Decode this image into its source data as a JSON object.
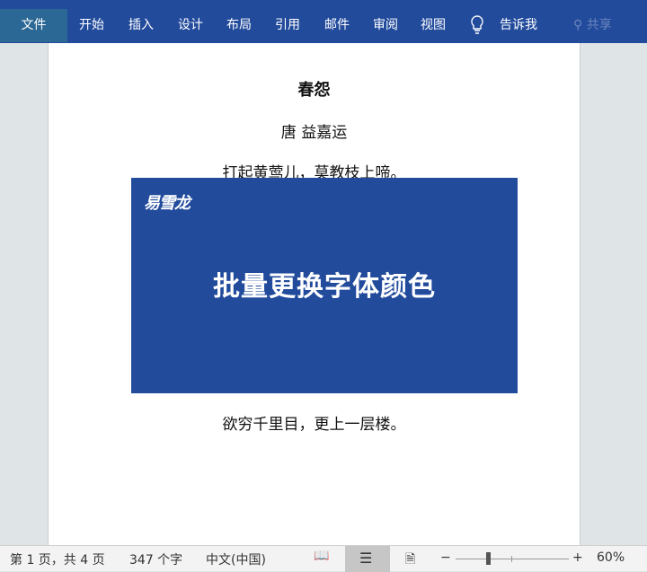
{
  "ribbon": {
    "tabs": [
      "文件",
      "开始",
      "插入",
      "设计",
      "布局",
      "引用",
      "邮件",
      "审阅",
      "视图"
    ],
    "tell_me": "告诉我",
    "share": "共享"
  },
  "document": {
    "title": "春怨",
    "author": "唐  益嘉运",
    "line1": "打起黄莺儿，莫教枝上啼。",
    "line2": "欲穷千里目，更上一层楼。",
    "banner": {
      "logo": "易雪龙",
      "headline": "批量更换字体颜色"
    }
  },
  "status": {
    "page": "第 1 页，共 4 页",
    "words": "347 个字",
    "language": "中文(中国)",
    "zoom_minus": "−",
    "zoom_plus": "+",
    "zoom": "60%",
    "zoom_percent": 60
  }
}
